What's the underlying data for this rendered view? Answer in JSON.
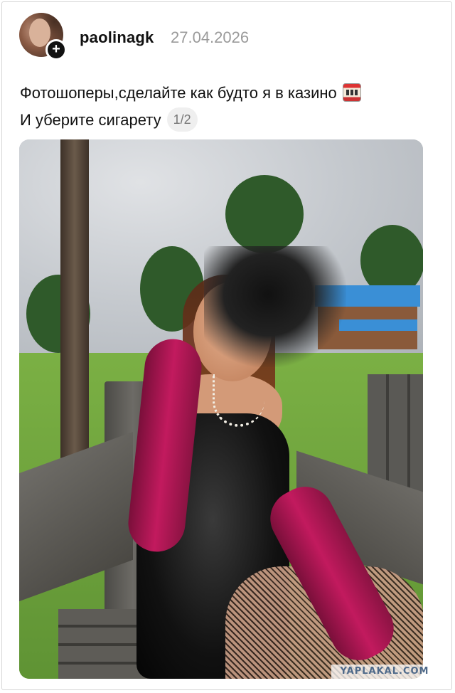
{
  "post": {
    "username": "paolinagk",
    "date": "27.04.2026",
    "caption_line1": "Фотошоперы,сделайте как будто я в казино",
    "caption_line2": "И уберите сигарету",
    "pager": "1/2",
    "caption_emoji": "slot-machine-icon"
  },
  "watermark": "YAPLAKAL.COM",
  "colors": {
    "username": "#111111",
    "date": "#9a9a9a",
    "pager_bg": "#efefef",
    "glove": "#c21a5e"
  }
}
